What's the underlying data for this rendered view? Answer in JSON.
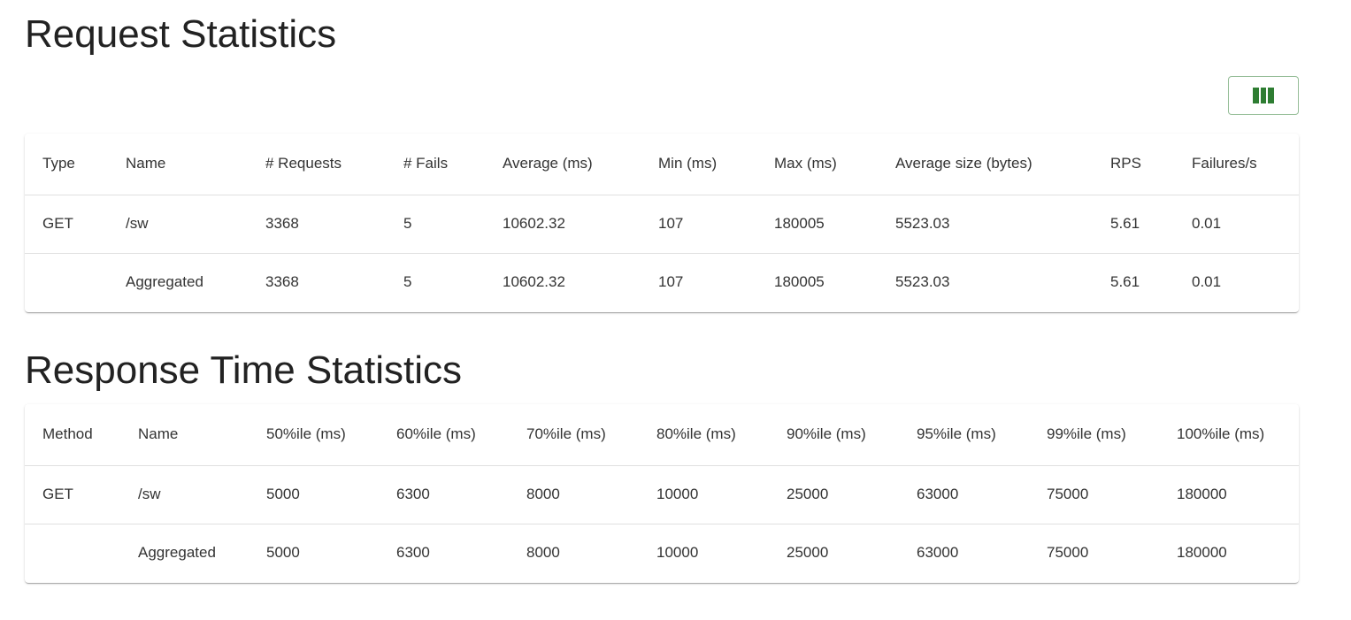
{
  "request_stats": {
    "title": "Request Statistics",
    "columns_button_icon": "view-column-icon",
    "headers": [
      "Type",
      "Name",
      "# Requests",
      "# Fails",
      "Average (ms)",
      "Min (ms)",
      "Max (ms)",
      "Average size (bytes)",
      "RPS",
      "Failures/s"
    ],
    "rows": [
      [
        "GET",
        "/sw",
        "3368",
        "5",
        "10602.32",
        "107",
        "180005",
        "5523.03",
        "5.61",
        "0.01"
      ],
      [
        "",
        "Aggregated",
        "3368",
        "5",
        "10602.32",
        "107",
        "180005",
        "5523.03",
        "5.61",
        "0.01"
      ]
    ]
  },
  "response_stats": {
    "title": "Response Time Statistics",
    "headers": [
      "Method",
      "Name",
      "50%ile (ms)",
      "60%ile (ms)",
      "70%ile (ms)",
      "80%ile (ms)",
      "90%ile (ms)",
      "95%ile (ms)",
      "99%ile (ms)",
      "100%ile (ms)"
    ],
    "rows": [
      [
        "GET",
        "/sw",
        "5000",
        "6300",
        "8000",
        "10000",
        "25000",
        "63000",
        "75000",
        "180000"
      ],
      [
        "",
        "Aggregated",
        "5000",
        "6300",
        "8000",
        "10000",
        "25000",
        "63000",
        "75000",
        "180000"
      ]
    ]
  },
  "colors": {
    "accent": "#2e7d32",
    "text": "#333333",
    "divider": "#e0e0e0"
  }
}
